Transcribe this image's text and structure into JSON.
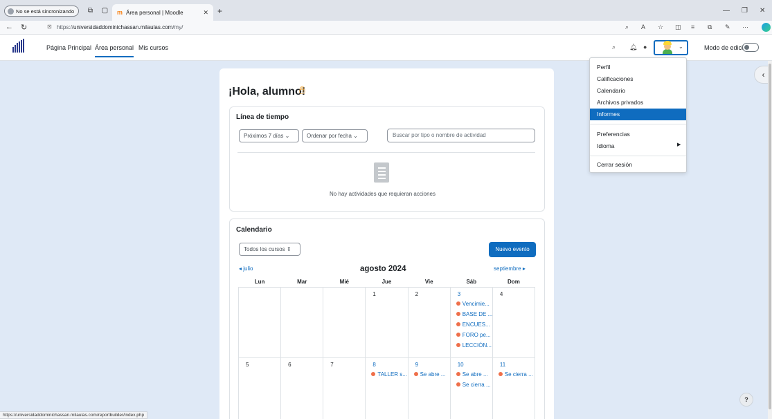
{
  "browser": {
    "sync_label": "No se está sincronizando",
    "tab_title": "Área personal | Moodle",
    "url_prefix": "https://",
    "url_host": "universidaddominichassan.milaulas.com",
    "url_path": "/my/",
    "status_url": "https://universidaddominichassan.milaulas.com/reportbuilder/index.php"
  },
  "navbar": {
    "links": [
      "Página Principal",
      "Área personal",
      "Mis cursos"
    ],
    "edit_mode_label": "Modo de edición"
  },
  "user_menu": {
    "items": [
      "Perfil",
      "Calificaciones",
      "Calendario",
      "Archivos privados",
      "Informes",
      "Preferencias",
      "Idioma",
      "Cerrar sesión"
    ],
    "highlighted": "Informes"
  },
  "greeting": "¡Hola, alumno!",
  "timeline": {
    "title": "Línea de tiempo",
    "filter_days": "Próximos 7 días",
    "sort": "Ordenar por fecha",
    "search_placeholder": "Buscar por tipo o nombre de actividad",
    "empty_text": "No hay actividades que requieran acciones"
  },
  "calendar": {
    "title": "Calendario",
    "course_filter": "Todos los cursos",
    "new_event": "Nuevo evento",
    "prev_month": "julio",
    "next_month": "septiembre",
    "month": "agosto 2024",
    "weekdays": [
      "Lun",
      "Mar",
      "Mié",
      "Jue",
      "Vie",
      "Sáb",
      "Dom"
    ],
    "week1": [
      {
        "day": "",
        "events": []
      },
      {
        "day": "",
        "events": []
      },
      {
        "day": "",
        "events": []
      },
      {
        "day": "1",
        "events": []
      },
      {
        "day": "2",
        "events": []
      },
      {
        "day": "3",
        "events": [
          "Vencimie...",
          "BASE DE ...",
          "ENCUES...",
          "FORO pe...",
          "LECCIÓN..."
        ]
      },
      {
        "day": "4",
        "events": []
      }
    ],
    "week2": [
      {
        "day": "5",
        "events": []
      },
      {
        "day": "6",
        "events": []
      },
      {
        "day": "7",
        "events": []
      },
      {
        "day": "8",
        "events": [
          "TALLER s..."
        ]
      },
      {
        "day": "9",
        "events": [
          "Se abre ..."
        ]
      },
      {
        "day": "10",
        "events": [
          "Se abre ...",
          "Se cierra ..."
        ]
      },
      {
        "day": "11",
        "events": [
          "Se cierra ..."
        ]
      }
    ]
  },
  "help_label": "?"
}
